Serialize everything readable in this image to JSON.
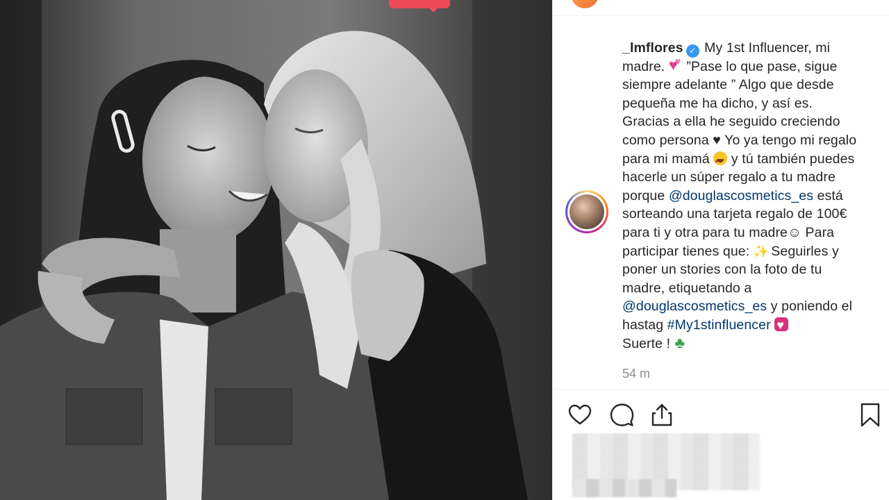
{
  "post": {
    "username": "_lmflores",
    "caption_lines": [
      [
        "My 1st Influencer, mi"
      ],
      [
        "madre. ",
        "”Pase lo que pase, sigue"
      ],
      [
        "siempre adelante ” Algo que desde"
      ],
      [
        "pequeña me ha dicho, y así es."
      ],
      [
        "Gracias a ella he seguido creciendo"
      ],
      [
        "como persona ",
        "♥",
        " Yo ya tengo mi regalo"
      ],
      [
        "para mi mamá ",
        " y tú también puedes"
      ],
      [
        "hacerle un súper regalo a tu madre"
      ],
      [
        "porque ",
        "@douglascosmetics_es",
        " está"
      ],
      [
        "sorteando una tarjeta regalo de 100€"
      ],
      [
        "para ti y otra para tu madre☺ Para"
      ],
      [
        "participar tienes que: ",
        " Seguirles y"
      ],
      [
        "poner un stories con la foto de tu"
      ],
      [
        "madre, etiquetando a"
      ],
      [
        "@douglascosmetics_es",
        " y poniendo el"
      ],
      [
        "hastag ",
        "#My1stinfluencer",
        ""
      ],
      [
        "Suerte ! ",
        ""
      ]
    ],
    "timestamp": "54 m"
  },
  "actions": {
    "like": "heart-icon",
    "comment": "comment-icon",
    "share": "share-icon",
    "save": "bookmark-icon"
  },
  "colors": {
    "link": "#00376b",
    "text": "#262626",
    "muted": "#8e8e8e",
    "verified": "#3897f0",
    "notification": "#ed4956"
  }
}
